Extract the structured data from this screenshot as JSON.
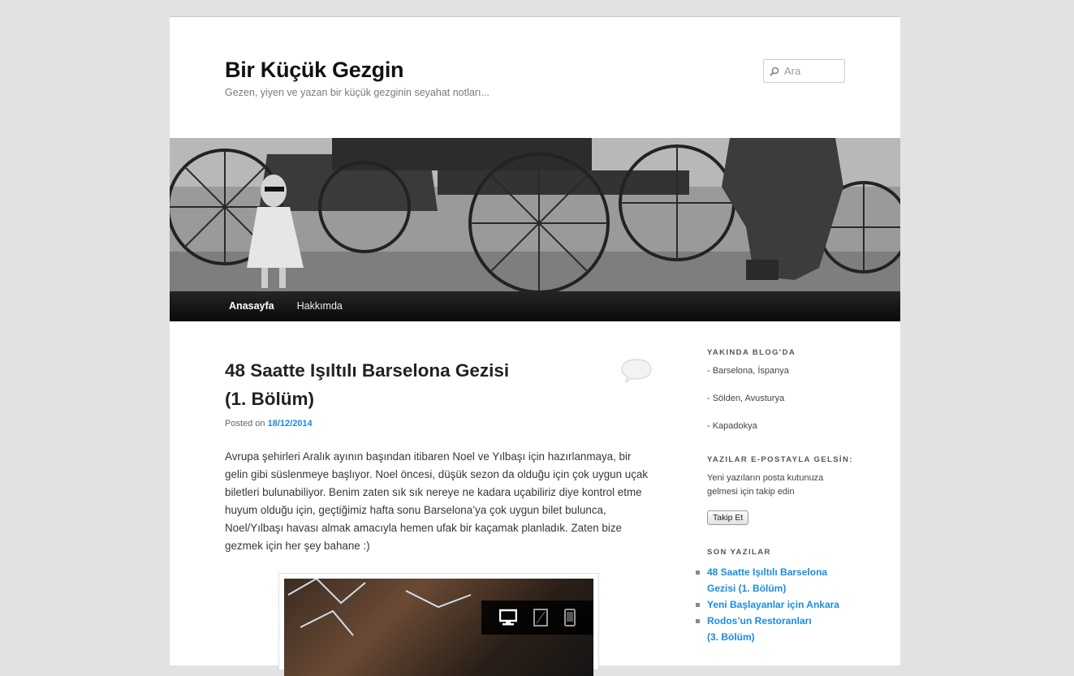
{
  "site": {
    "title": "Bir Küçük Gezgin",
    "description": "Gezen, yiyen ve yazan bir küçük gezginin seyahat notları..."
  },
  "search": {
    "placeholder": "Ara"
  },
  "nav": {
    "items": [
      "Anasayfa",
      "Hakkımda"
    ]
  },
  "post": {
    "title_line1": "48 Saatte Işıltılı Barselona Gezisi",
    "title_line2": "(1. Bölüm)",
    "posted_on": "Posted on",
    "date": "18/12/2014",
    "body": "Avrupa şehirleri Aralık ayının başından itibaren Noel ve Yılbaşı için hazırlanmaya, bir gelin gibi süslenmeye başlıyor. Noel öncesi, düşük sezon da olduğu için çok uygun uçak biletleri bulunabiliyor. Benim zaten sık sık nereye ne kadara uçabiliriz diye kontrol etme huyum olduğu için, geçtiğimiz hafta sonu Barselona’ya çok uygun bilet bulunca, Noel/Yılbaşı havası almak amacıyla hemen ufak bir kaçamak planladık. Zaten bize gezmek için her şey bahane :)"
  },
  "sidebar": {
    "upcoming": {
      "title": "YAKINDA BLOG'DA",
      "items": [
        "- Barselona, İspanya",
        "- Sölden, Avusturya",
        "- Kapadokya"
      ]
    },
    "email": {
      "title": "YAZILAR E-POSTAYLA GELSİN:",
      "text": "Yeni yazıların posta kutunuza gelmesi için takip edin",
      "button": "Takip Et"
    },
    "recent": {
      "title": "SON YAZILAR",
      "items": [
        "48 Saatte Işıltılı Barselona Gezisi (1. Bölüm)",
        "Yeni Başlayanlar için Ankara",
        "Rodos’un Restoranları (3. Bölüm)"
      ]
    }
  },
  "icons": [
    "search-icon",
    "comment-bubble-icon",
    "desktop-view-icon",
    "tablet-view-icon",
    "phone-view-icon"
  ],
  "colors": {
    "link": "#1b8be0",
    "nav_bg": "#111111",
    "page_bg": "#e2e2e2"
  }
}
